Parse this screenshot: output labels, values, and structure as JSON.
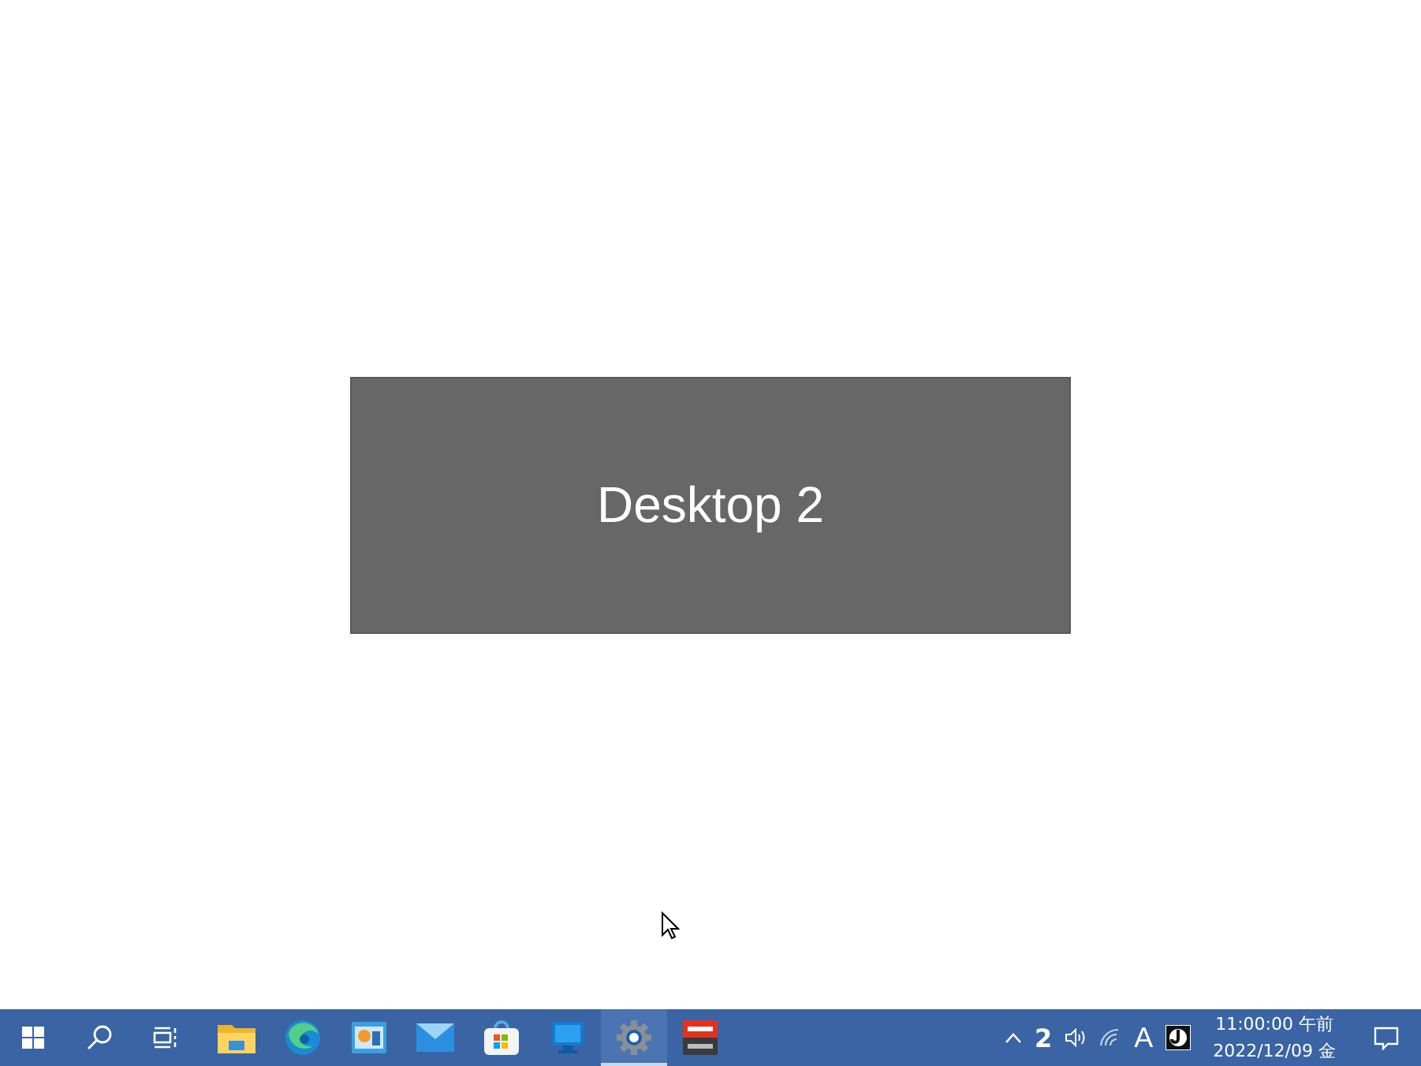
{
  "desktop": {
    "card_title": "Desktop 2"
  },
  "taskbar": {
    "apps": [
      {
        "kind": "folder",
        "selected": false
      },
      {
        "kind": "browser",
        "selected": false
      },
      {
        "kind": "chart",
        "selected": false
      },
      {
        "kind": "mail",
        "selected": false
      },
      {
        "kind": "store",
        "selected": false
      },
      {
        "kind": "monitor",
        "selected": false
      },
      {
        "kind": "gear",
        "selected": true
      },
      {
        "kind": "mixer",
        "selected": false
      }
    ],
    "tray": {
      "desktop_number": "2",
      "input_mode": "A",
      "time": "11:00:00 午前",
      "date": "2022/12/09 金"
    }
  }
}
